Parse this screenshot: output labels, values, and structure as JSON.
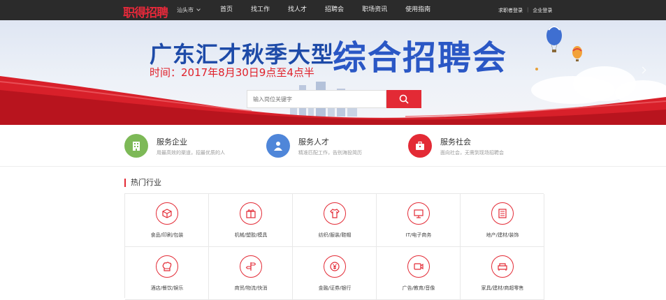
{
  "header": {
    "logo": "职得招聘",
    "city": "汕头市",
    "nav": [
      "首页",
      "找工作",
      "找人才",
      "招聘会",
      "职场资讯",
      "使用指南"
    ],
    "auth": {
      "seeker_login": "求职者登录",
      "company_login": "企业登录"
    }
  },
  "banner": {
    "title_left": "广东汇才秋季大型",
    "title_right": "综合招聘会",
    "time": "时间：2017年8月30日9点至4点半",
    "search_placeholder": "输入岗位关键字"
  },
  "services": [
    {
      "title": "服务企业",
      "desc": "用最高效的渠道，招最优质的人",
      "icon": "building-icon",
      "color": "#7db957"
    },
    {
      "title": "服务人才",
      "desc": "精准匹配工作，告别海投简历",
      "icon": "person-icon",
      "color": "#4f86d9"
    },
    {
      "title": "服务社会",
      "desc": "面向社会，无需到现场招聘会",
      "icon": "briefcase-icon",
      "color": "#e32a35"
    }
  ],
  "hot": {
    "title": "热门行业",
    "items": [
      {
        "label": "食品/印刷/包装",
        "icon": "box-icon"
      },
      {
        "label": "机械/塑胶/模具",
        "icon": "gift-icon"
      },
      {
        "label": "纺织/服装/鞋帽",
        "icon": "tshirt-icon"
      },
      {
        "label": "IT/电子商务",
        "icon": "monitor-icon"
      },
      {
        "label": "地产/建材/装饰",
        "icon": "building-icon"
      },
      {
        "label": "酒店/餐饮/娱乐",
        "icon": "chef-hat-icon"
      },
      {
        "label": "商贸/物流/快消",
        "icon": "signpost-icon"
      },
      {
        "label": "金融/证券/银行",
        "icon": "yuan-icon"
      },
      {
        "label": "广告/教育/音像",
        "icon": "video-icon"
      },
      {
        "label": "家具/建材/商超零售",
        "icon": "sofa-icon"
      }
    ]
  },
  "colors": {
    "accent": "#e32a35",
    "topbar": "#2b2b2b",
    "banner_blue": "#2a57c5"
  }
}
